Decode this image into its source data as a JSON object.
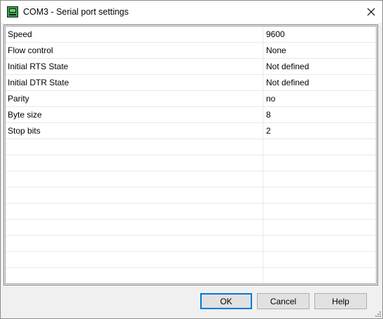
{
  "window": {
    "title": "COM3 - Serial port settings",
    "close_glyph": "✕"
  },
  "settings": {
    "rows": [
      {
        "key": "Speed",
        "value": "9600"
      },
      {
        "key": "Flow control",
        "value": "None"
      },
      {
        "key": "Initial RTS State",
        "value": "Not defined"
      },
      {
        "key": "Initial DTR State",
        "value": "Not defined"
      },
      {
        "key": "Parity",
        "value": "no"
      },
      {
        "key": "Byte size",
        "value": "8"
      },
      {
        "key": "Stop bits",
        "value": "2"
      },
      {
        "key": "",
        "value": ""
      },
      {
        "key": "",
        "value": ""
      },
      {
        "key": "",
        "value": ""
      },
      {
        "key": "",
        "value": ""
      },
      {
        "key": "",
        "value": ""
      },
      {
        "key": "",
        "value": ""
      },
      {
        "key": "",
        "value": ""
      },
      {
        "key": "",
        "value": ""
      },
      {
        "key": "",
        "value": ""
      }
    ]
  },
  "buttons": {
    "ok": "OK",
    "cancel": "Cancel",
    "help": "Help"
  },
  "icons": {
    "app": "serial-port-app-icon",
    "close": "close-icon",
    "grip": "resize-grip-icon"
  },
  "colors": {
    "titlebar": "#ffffff",
    "dialog": "#f0f0f0",
    "grid": "#ffffff",
    "default_button_border": "#0078d7"
  }
}
